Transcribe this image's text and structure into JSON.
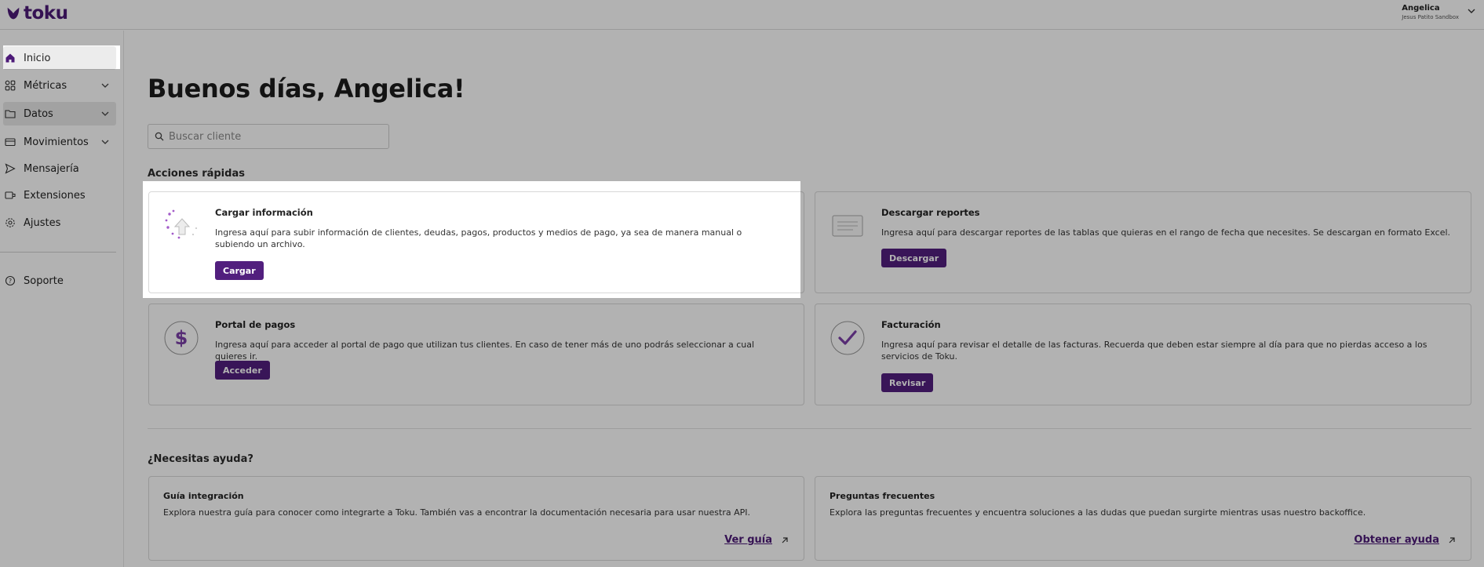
{
  "brand": {
    "name": "toku",
    "color": "#4d1a78"
  },
  "user": {
    "name": "Angelica",
    "org": "Jesus Patito Sandbox"
  },
  "sidebar": {
    "items": [
      {
        "label": "Inicio",
        "icon": "home-icon"
      },
      {
        "label": "Métricas",
        "icon": "grid-icon"
      },
      {
        "label": "Datos",
        "icon": "folder-icon"
      },
      {
        "label": "Movimientos",
        "icon": "card-icon"
      },
      {
        "label": "Mensajería",
        "icon": "send-icon"
      },
      {
        "label": "Extensiones",
        "icon": "extensions-icon"
      },
      {
        "label": "Ajustes",
        "icon": "gear-icon"
      }
    ],
    "support": {
      "label": "Soporte",
      "icon": "help-icon"
    }
  },
  "main": {
    "greeting": "Buenos días, Angelica!",
    "search": {
      "placeholder": "Buscar cliente"
    },
    "quick_actions_title": "Acciones rápidas",
    "cards": [
      {
        "title": "Cargar información",
        "desc": "Ingresa aquí para subir información de clientes, deudas, pagos, productos y medios de pago, ya sea de manera manual o subiendo un archivo.",
        "button": "Cargar"
      },
      {
        "title": "Descargar reportes",
        "desc": "Ingresa aquí para descargar reportes de las tablas que quieras en el rango de fecha que necesites. Se descargan en formato Excel.",
        "button": "Descargar"
      },
      {
        "title": "Portal de pagos",
        "desc": "Ingresa aquí para acceder al portal de pago que utilizan tus clientes. En caso de tener más de uno podrás seleccionar a cual quieres ir.",
        "button": "Acceder"
      },
      {
        "title": "Facturación",
        "desc": "Ingresa aquí para revisar el detalle de las facturas. Recuerda que deben estar siempre al día para que no pierdas acceso a los servicios de Toku.",
        "button": "Revisar"
      }
    ],
    "help_title": "¿Necesitas ayuda?",
    "help_cards": [
      {
        "title": "Guía integración",
        "desc": "Explora nuestra guía para conocer como integrarte a Toku. También vas a encontrar la documentación necesaria para usar nuestra API.",
        "link": "Ver guía"
      },
      {
        "title": "Preguntas frecuentes",
        "desc": "Explora las preguntas frecuentes y encuentra soluciones a las dudas que puedan surgirte mientras usas nuestro backoffice.",
        "link": "Obtener ayuda"
      }
    ]
  },
  "colors": {
    "accent": "#521f7e",
    "overlay": "rgba(0,0,0,0.30)"
  }
}
